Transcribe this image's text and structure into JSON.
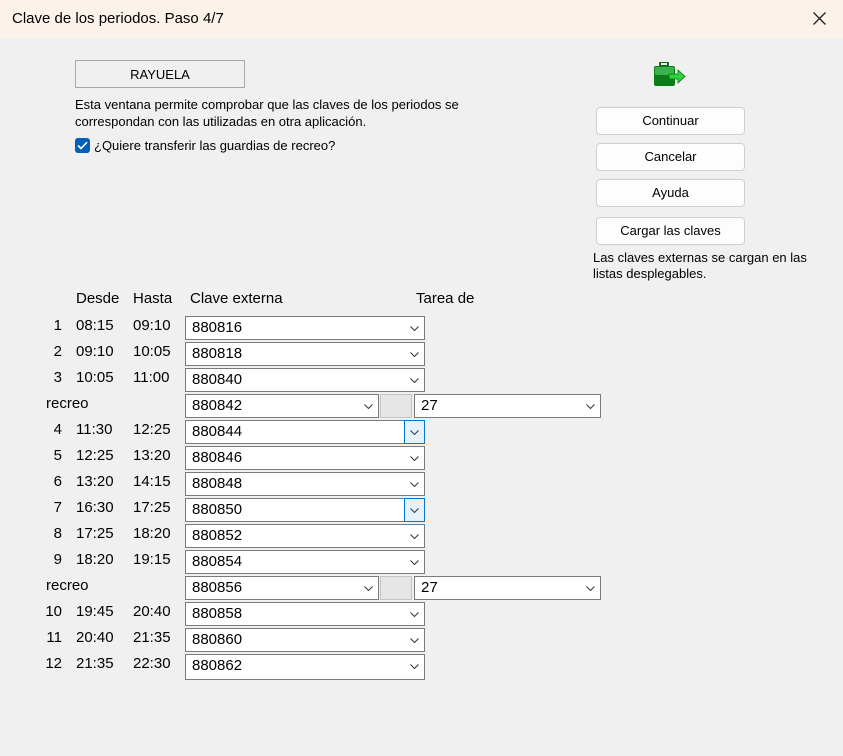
{
  "window": {
    "title": "Clave de los periodos. Paso 4/7"
  },
  "program_name": "RAYUELA",
  "intro_text": "Esta ventana permite comprobar que las claves de los periodos se correspondan con las utilizadas en otra aplicación.",
  "guardias_checkbox": {
    "label": "¿Quiere transferir las guardias de recreo?",
    "checked": true
  },
  "buttons": {
    "continuar": "Continuar",
    "cancelar": "Cancelar",
    "ayuda": "Ayuda",
    "cargar": "Cargar las claves"
  },
  "note_text": "Las claves externas se cargan en las listas desplegables.",
  "headers": {
    "desde": "Desde",
    "hasta": "Hasta",
    "clave": "Clave externa",
    "tarea": "Tarea de"
  },
  "periods": [
    {
      "num": "1",
      "desde": "08:15",
      "hasta": "09:10",
      "clave": "880816"
    },
    {
      "num": "2",
      "desde": "09:10",
      "hasta": "10:05",
      "clave": "880818"
    },
    {
      "num": "3",
      "desde": "10:05",
      "hasta": "11:00",
      "clave": "880840"
    },
    {
      "num": "4",
      "desde": "11:30",
      "hasta": "12:25",
      "clave": "880844"
    },
    {
      "num": "5",
      "desde": "12:25",
      "hasta": "13:20",
      "clave": "880846"
    },
    {
      "num": "6",
      "desde": "13:20",
      "hasta": "14:15",
      "clave": "880848"
    },
    {
      "num": "7",
      "desde": "16:30",
      "hasta": "17:25",
      "clave": "880850"
    },
    {
      "num": "8",
      "desde": "17:25",
      "hasta": "18:20",
      "clave": "880852"
    },
    {
      "num": "9",
      "desde": "18:20",
      "hasta": "19:15",
      "clave": "880854"
    },
    {
      "num": "10",
      "desde": "19:45",
      "hasta": "20:40",
      "clave": "880858"
    },
    {
      "num": "11",
      "desde": "20:40",
      "hasta": "21:35",
      "clave": "880860"
    },
    {
      "num": "12",
      "desde": "21:35",
      "hasta": "22:30",
      "clave": "880862"
    }
  ],
  "recreos": [
    {
      "label": "recreo",
      "clave": "880842",
      "tarea": "27"
    },
    {
      "label": "recreo",
      "clave": "880856",
      "tarea": "27"
    }
  ],
  "colors": {
    "accent": "#005fb8",
    "icon_green": "#1f9a2e"
  }
}
